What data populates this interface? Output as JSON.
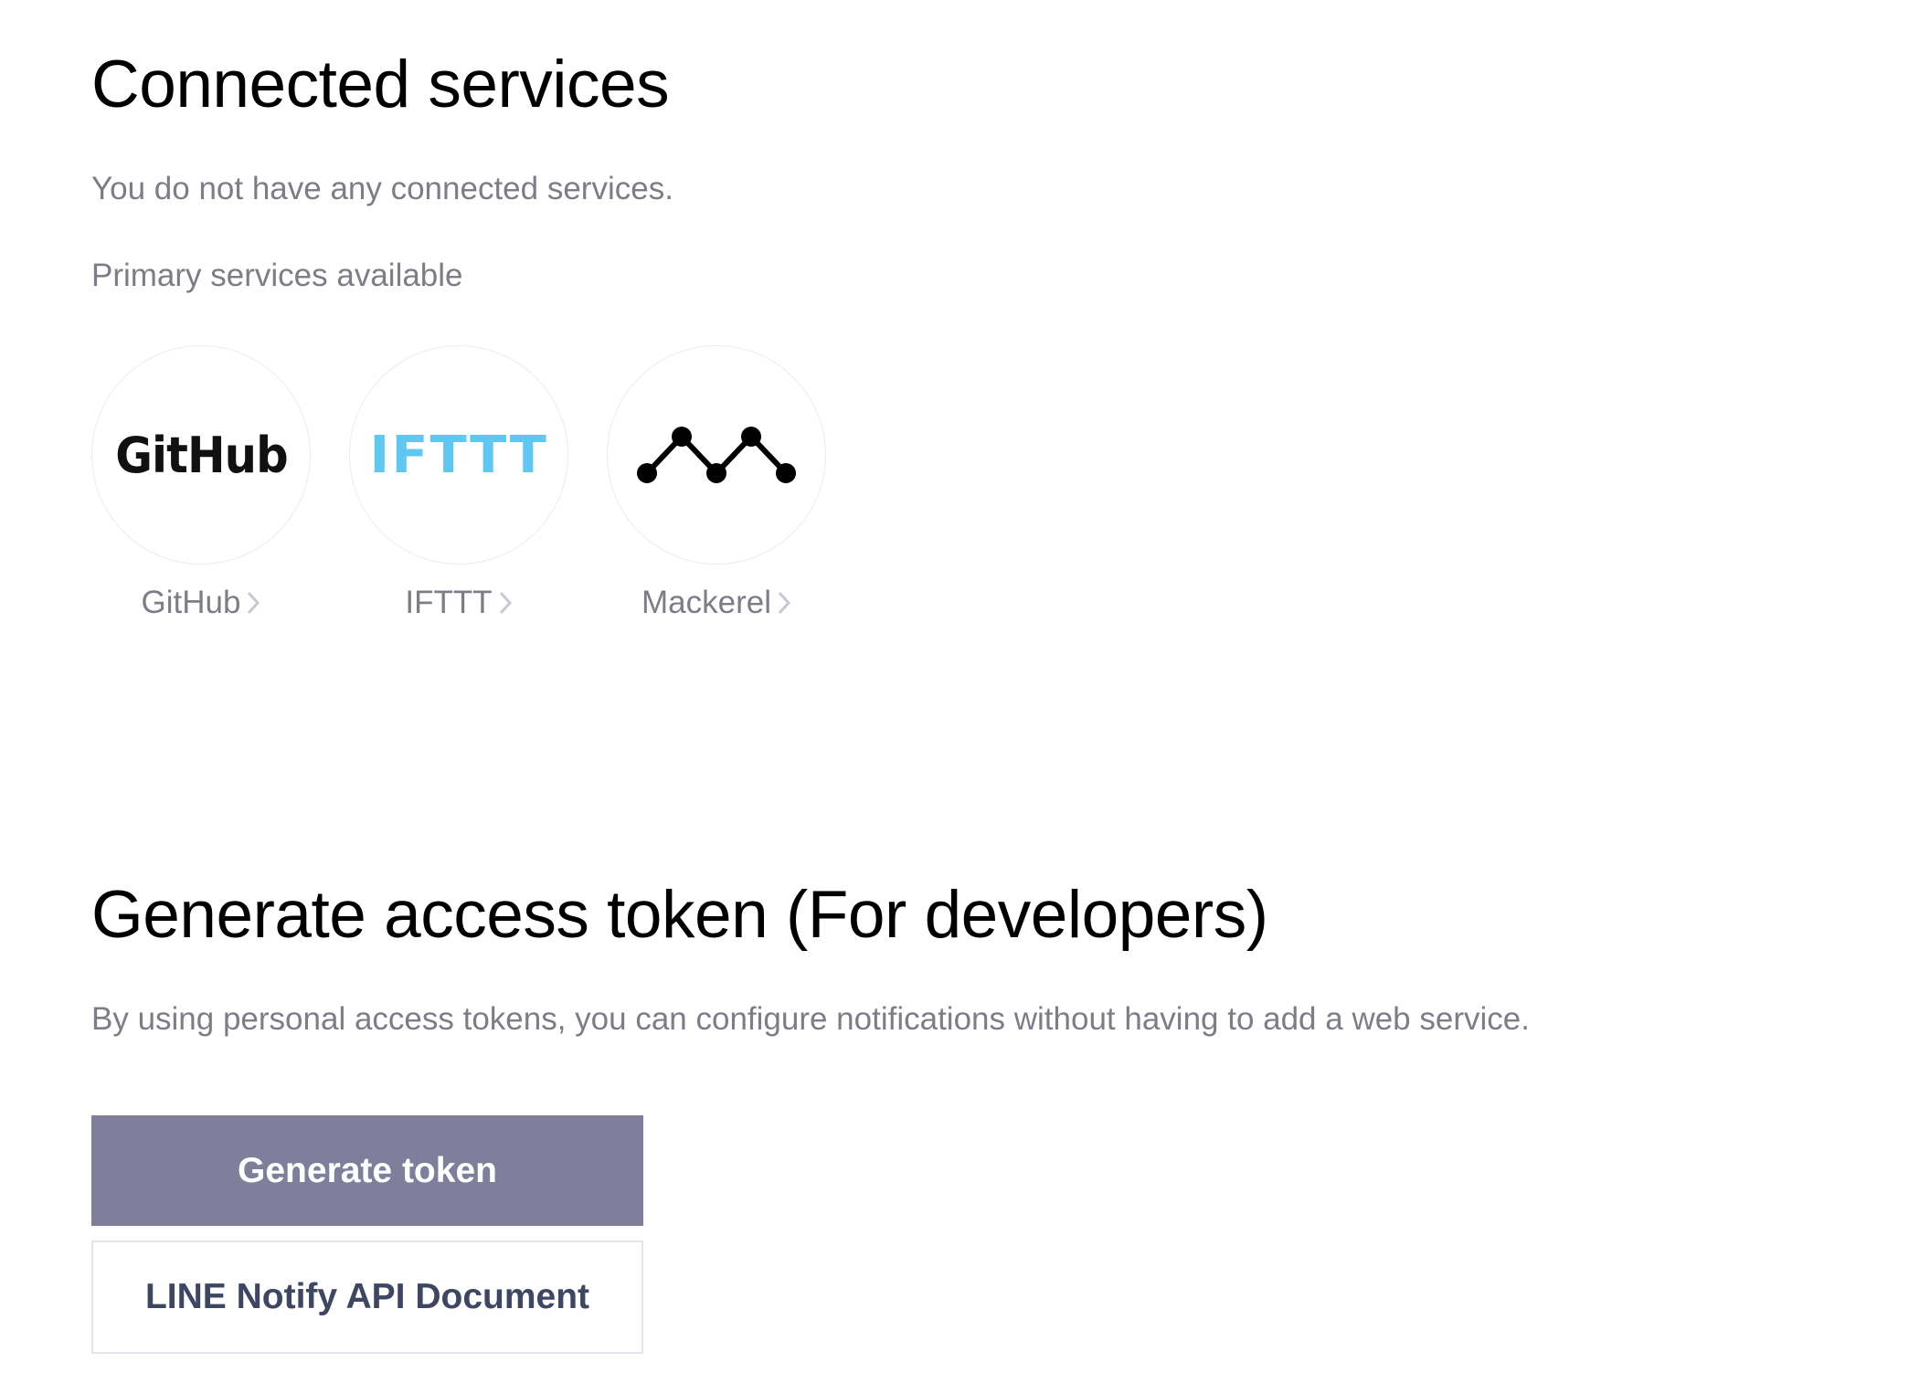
{
  "connected": {
    "title": "Connected services",
    "empty_message": "You do not have any connected services.",
    "primary_label": "Primary services available"
  },
  "services": [
    {
      "name": "GitHub",
      "logo_text": "GitHub",
      "icon": "github-logo"
    },
    {
      "name": "IFTTT",
      "logo_text": "IFTTT",
      "icon": "ifttt-logo",
      "color": "#5ec7f2"
    },
    {
      "name": "Mackerel",
      "icon": "mackerel-logo"
    }
  ],
  "token": {
    "title": "Generate access token (For developers)",
    "description": "By using personal access tokens, you can configure notifications without having to add a web service.",
    "generate_label": "Generate token",
    "doc_label": "LINE Notify API Document"
  },
  "colors": {
    "primary_button": "#7f7f9c",
    "muted_text": "#7d7d87",
    "doc_text": "#3d4663"
  }
}
